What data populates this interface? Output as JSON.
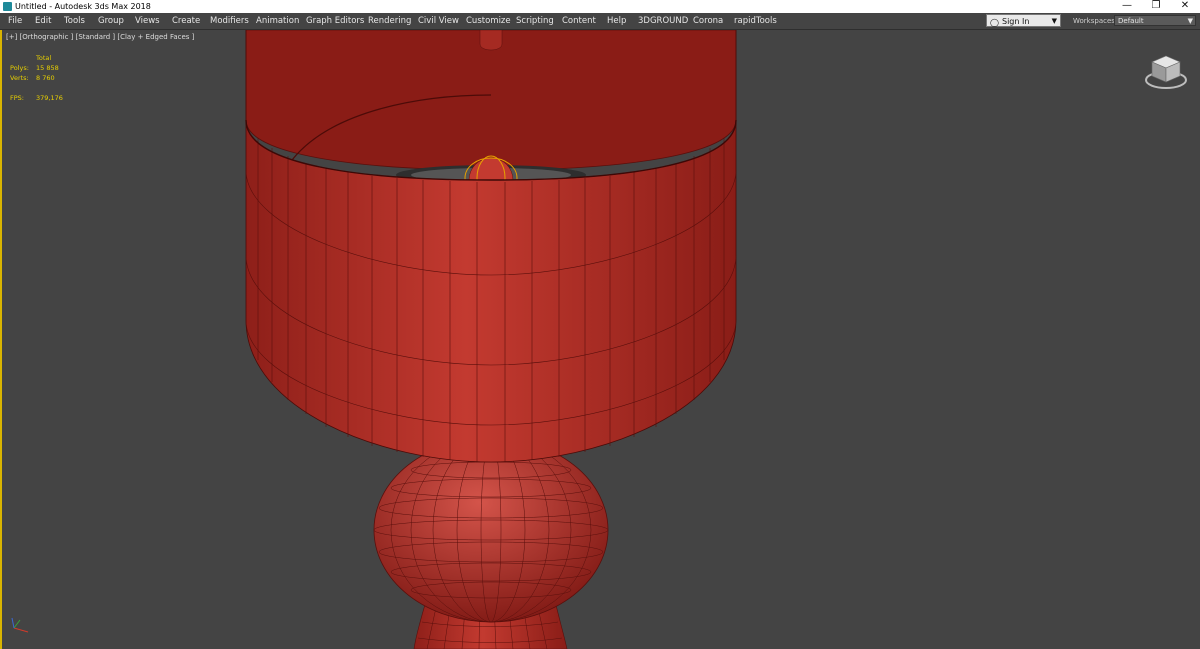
{
  "titlebar": {
    "title": "Untitled - Autodesk 3ds Max 2018",
    "app_icon": "3dsmax-app-icon",
    "minimize": "—",
    "maximize": "❐",
    "close": "✕"
  },
  "menu": {
    "items": [
      "File",
      "Edit",
      "Tools",
      "Group",
      "Views",
      "Create",
      "Modifiers",
      "Animation",
      "Graph Editors",
      "Rendering",
      "Civil View",
      "Customize",
      "Scripting",
      "Content",
      "Help",
      "3DGROUND",
      "Corona",
      "rapidTools"
    ],
    "signin": {
      "icon": "person-icon",
      "label": "Sign In",
      "dropdown": "▼"
    },
    "workspaces_label": "Workspaces:",
    "workspaces_value": "Default",
    "workspaces_dropdown": "▼"
  },
  "viewport": {
    "label": "[+] [Orthographic ] [Standard ] [Clay + Edged Faces ]",
    "stats": {
      "total": "Total",
      "polys_label": "Polys:",
      "polys_value": "15 858",
      "verts_label": "Verts:",
      "verts_value": "8 760",
      "fps_label": "FPS:",
      "fps_value": "379,176"
    },
    "colors": {
      "accent": "#d9b400",
      "mesh": "#b8322a",
      "mesh_edge": "#5a0f0c",
      "background": "#444444"
    }
  }
}
